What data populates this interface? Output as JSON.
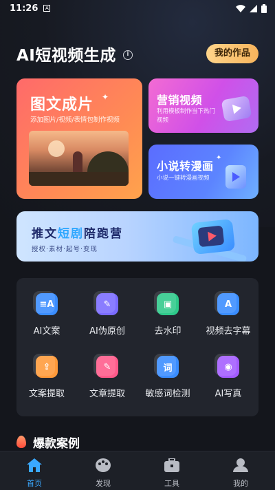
{
  "status_bar": {
    "time": "11:26",
    "notif": "A"
  },
  "header": {
    "title": "AI短视频生成",
    "works_button": "我的作品"
  },
  "cards": {
    "big": {
      "title": "图文成片",
      "subtitle": "添加图片/视频/表情包制作视频"
    },
    "marketing": {
      "title": "营销视频",
      "subtitle": "利用模板制作当下热门视频"
    },
    "novel": {
      "title": "小说转漫画",
      "subtitle": "小说一键转漫画视频"
    }
  },
  "banner": {
    "title_pre": "推文",
    "title_hl": "短剧",
    "title_post": "陪跑营",
    "subtitle": "授权·素材·起号·变现"
  },
  "tools": [
    {
      "label": "AI文案",
      "icon": "ai-copywriting-icon",
      "color": "#3a8dff",
      "glyph": "≡A"
    },
    {
      "label": "AI伪原创",
      "icon": "ai-rewrite-icon",
      "color": "#7a6bff",
      "glyph": "✎"
    },
    {
      "label": "去水印",
      "icon": "remove-watermark-icon",
      "color": "#2ec98a",
      "glyph": "▣"
    },
    {
      "label": "视频去字幕",
      "icon": "remove-subtitle-icon",
      "color": "#3a8dff",
      "glyph": "A"
    },
    {
      "label": "文案提取",
      "icon": "extract-copy-icon",
      "color": "#ff9a3a",
      "glyph": "⇪"
    },
    {
      "label": "文章提取",
      "icon": "extract-article-icon",
      "color": "#ff5a8a",
      "glyph": "✎"
    },
    {
      "label": "敏感词检测",
      "icon": "sensitive-word-icon",
      "color": "#3a8dff",
      "glyph": "词"
    },
    {
      "label": "AI写真",
      "icon": "ai-portrait-icon",
      "color": "#a35cff",
      "glyph": "◉"
    }
  ],
  "section": {
    "title": "爆款案例"
  },
  "tabbar": [
    {
      "label": "首页",
      "icon": "home-icon",
      "active": true
    },
    {
      "label": "发现",
      "icon": "discover-icon",
      "active": false
    },
    {
      "label": "工具",
      "icon": "toolbox-icon",
      "active": false
    },
    {
      "label": "我的",
      "icon": "profile-icon",
      "active": false
    }
  ],
  "colors": {
    "accent": "#3aa8ff",
    "background": "#14161c",
    "panel": "#22252d"
  }
}
